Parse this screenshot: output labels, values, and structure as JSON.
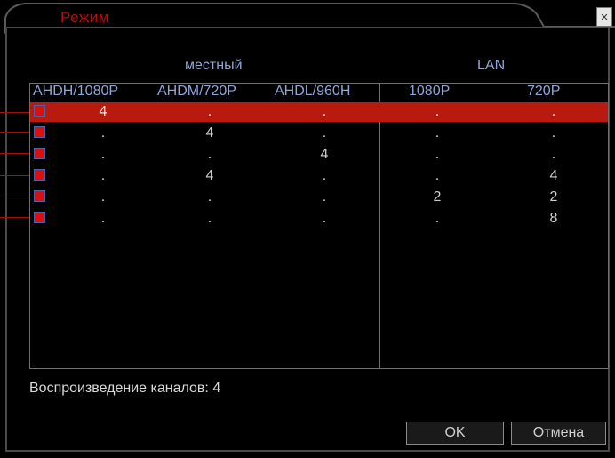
{
  "window": {
    "title": "Режим",
    "close_symbol": "×"
  },
  "groups": {
    "local": "местный",
    "lan": "LAN"
  },
  "columns": {
    "local": [
      "AHDH/1080P",
      "AHDM/720P",
      "AHDL/960H"
    ],
    "lan": [
      "1080P",
      "720P"
    ]
  },
  "rows": [
    {
      "checked": true,
      "selected": true,
      "values": [
        "4",
        ".",
        ".",
        ".",
        "."
      ]
    },
    {
      "checked": true,
      "selected": false,
      "values": [
        ".",
        "4",
        ".",
        ".",
        "."
      ]
    },
    {
      "checked": true,
      "selected": false,
      "values": [
        ".",
        ".",
        "4",
        ".",
        "."
      ]
    },
    {
      "checked": true,
      "selected": false,
      "values": [
        ".",
        "4",
        ".",
        ".",
        "4"
      ]
    },
    {
      "checked": true,
      "selected": false,
      "values": [
        ".",
        ".",
        ".",
        "2",
        "2"
      ]
    },
    {
      "checked": true,
      "selected": false,
      "values": [
        ".",
        ".",
        ".",
        ".",
        "8"
      ]
    }
  ],
  "status": {
    "label": "Воспроизведение каналов: 4"
  },
  "buttons": {
    "ok": "OK",
    "cancel": "Отмена"
  },
  "colors": {
    "accent_red": "#b81a10",
    "header_blue": "#8fa6d8",
    "background": "#000000"
  }
}
